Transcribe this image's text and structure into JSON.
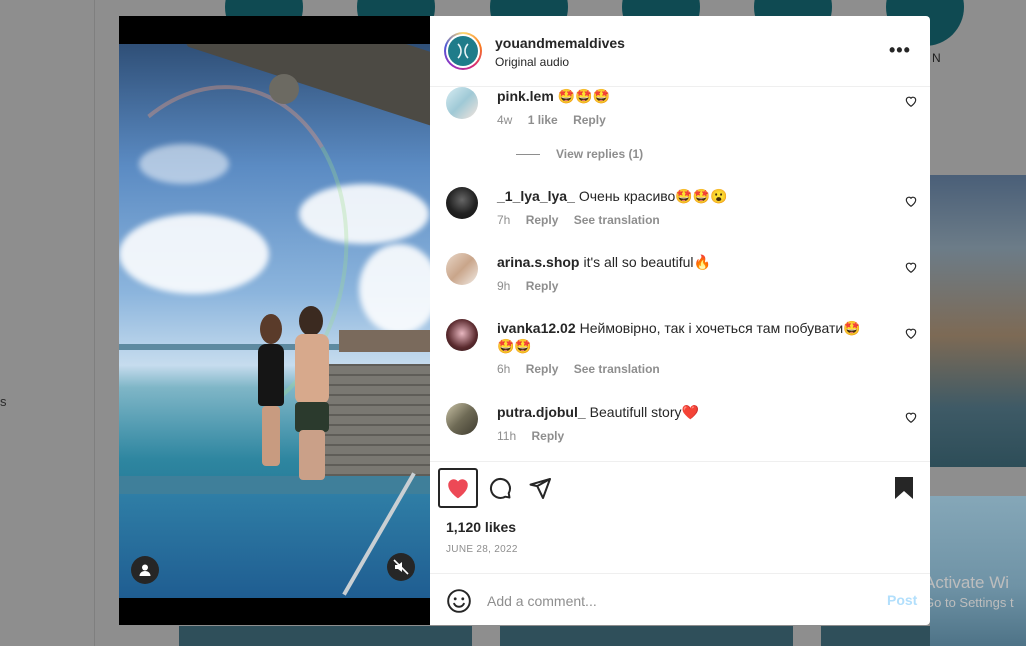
{
  "post": {
    "username": "youandmemaldives",
    "audio": "Original audio",
    "likes": "1,120 likes",
    "date": "JUNE 28, 2022"
  },
  "comments": [
    {
      "user": "pink.lem",
      "text": "🤩🤩🤩",
      "time": "4w",
      "likes": "1 like",
      "reply": "Reply",
      "translate": ""
    },
    {
      "user": "_1_lya_lya_",
      "text": "Очень красиво🤩🤩😮",
      "time": "7h",
      "likes": "",
      "reply": "Reply",
      "translate": "See translation"
    },
    {
      "user": "arina.s.shop",
      "text": "it's all so beautiful🔥",
      "time": "9h",
      "likes": "",
      "reply": "Reply",
      "translate": ""
    },
    {
      "user": "ivanka12.02",
      "text": "Неймовірно, так і хочеться там побувати🤩🤩🤩",
      "time": "6h",
      "likes": "",
      "reply": "Reply",
      "translate": "See translation"
    },
    {
      "user": "putra.djobul_",
      "text": "Beautifull story❤️",
      "time": "11h",
      "likes": "",
      "reply": "Reply",
      "translate": ""
    }
  ],
  "view_replies": "View replies (1)",
  "add_comment": {
    "placeholder": "Add a comment...",
    "post_label": "Post"
  },
  "background": {
    "highlight_label_partial": "N",
    "edge_text": "s"
  },
  "watermark": {
    "title": "Activate Wi",
    "subtitle": "Go to Settings t"
  },
  "colors": {
    "like_red": "#ed4956",
    "link_blue": "#0095f6",
    "post_disabled": "#b2dffc"
  }
}
